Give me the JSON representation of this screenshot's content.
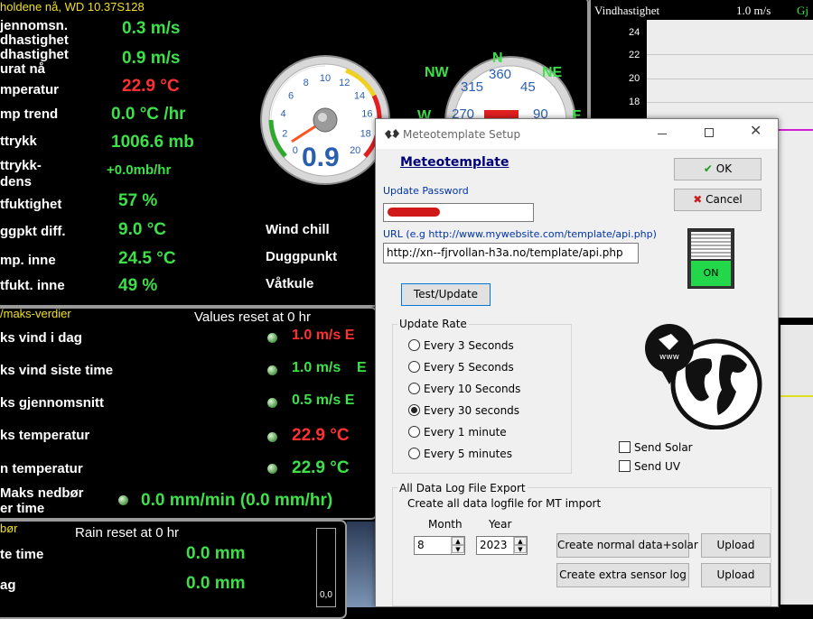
{
  "current": {
    "header": "holdene nå, WD 10.37S128",
    "rows": [
      {
        "label": "jennomsn.",
        "value": "0.3 m/s"
      },
      {
        "label": "dhastighet",
        "value": ""
      },
      {
        "label": "dhastighet",
        "value": "0.9 m/s"
      },
      {
        "label": "urat nå",
        "value": ""
      },
      {
        "label": "mperatur",
        "value": "22.9 °C"
      },
      {
        "label": "mp trend",
        "value": "0.0 °C /hr"
      },
      {
        "label": "ttrykk",
        "value": "1006.6 mb"
      },
      {
        "label": "ttrykk-",
        "value": "+0.0mb/hr"
      },
      {
        "label": "dens",
        "value": ""
      },
      {
        "label": "tfuktighet",
        "value": "57 %"
      },
      {
        "label": "ggpkt diff.",
        "value": "9.0 °C"
      },
      {
        "label": "mp. inne",
        "value": "24.5 °C"
      },
      {
        "label": "tfukt. inne",
        "value": "49 %"
      }
    ],
    "side_labels": [
      "Wind chill",
      "Duggpunkt",
      "Våtkule"
    ]
  },
  "gauge_speed": {
    "value": "0.9",
    "ticks": [
      "0",
      "2",
      "4",
      "6",
      "8",
      "10",
      "12",
      "14",
      "16",
      "18",
      "20"
    ],
    "level": 0.045
  },
  "gauge_dir": {
    "labels": [
      "NW",
      "N",
      "NE",
      "W",
      "E"
    ],
    "ticks": [
      "315",
      "360",
      "45",
      "270",
      "90"
    ]
  },
  "chart": {
    "title": "Vindhastighet",
    "current": "1.0 m/s",
    "legend": "Gj",
    "y_ticks": [
      "24",
      "22",
      "20",
      "18"
    ]
  },
  "maxmin": {
    "header": "/maks-verdier",
    "reset": "Values reset at 0 hr",
    "rows": [
      {
        "label": "ks vind i dag",
        "value": "1.0 m/s  E"
      },
      {
        "label": "ks vind siste time",
        "value": "1.0 m/s    E"
      },
      {
        "label": "ks gjennomsnitt",
        "value": "0.5 m/s  E"
      },
      {
        "label": "ks temperatur",
        "value": "22.9 °C"
      },
      {
        "label": "n temperatur",
        "value": "22.9 °C"
      },
      {
        "label": "Maks nedbør",
        "value": "0.0 mm/min (0.0 mm/hr)"
      },
      {
        "label": "er time",
        "value": ""
      }
    ]
  },
  "rain": {
    "header": "bør",
    "reset": "Rain reset at 0 hr",
    "rows": [
      {
        "label": "te time",
        "value": "0.0 mm"
      },
      {
        "label": "ag",
        "value": "0.0 mm"
      }
    ],
    "bar_value": "0,0"
  },
  "dialog": {
    "title": "Meteotemplate Setup",
    "heading": "Meteotemplate",
    "ok": "OK",
    "cancel": "Cancel",
    "password_label": "Update Password",
    "url_label": "URL (e.g http://www.mywebsite.com/template/api.php)",
    "url_value": "http://xn--fjrvollan-h3a.no/template/api.php",
    "switch_label": "ON",
    "test_button": "Test/Update",
    "rate_group": "Update Rate",
    "rates": [
      "Every 3 Seconds",
      "Every 5 Seconds",
      "Every 10 Seconds",
      "Every 30 seconds",
      "Every 1 minute",
      "Every 5 minutes"
    ],
    "selected_rate": "Every 30 seconds",
    "send_solar": "Send Solar",
    "send_uv": "Send UV",
    "export_group": "All Data Log File Export",
    "export_note": "Create all data logfile for MT import",
    "month_label": "Month",
    "year_label": "Year",
    "month_value": "8",
    "year_value": "2023",
    "create_normal": "Create normal data+solar",
    "create_extra": "Create extra sensor log",
    "upload": "Upload",
    "globe_text": "www"
  },
  "colors": {
    "green": "#3ee04a",
    "red": "#ff3030",
    "yellow": "#f0e020",
    "link": "#00007a"
  }
}
